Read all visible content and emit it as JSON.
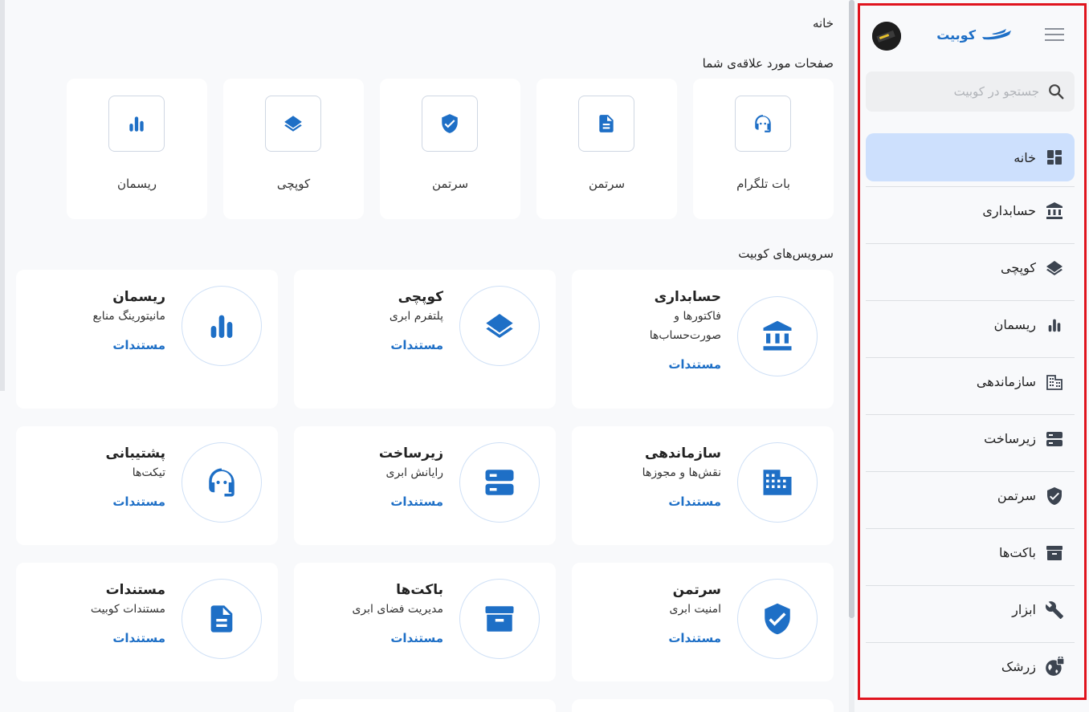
{
  "breadcrumb": "خانه",
  "favorites": {
    "title": "صفحات مورد علاقه‌ی شما",
    "items": [
      {
        "label": "بات تلگرام",
        "icon": "headset-icon"
      },
      {
        "label": "سرتمن",
        "icon": "document-icon"
      },
      {
        "label": "سرتمن",
        "icon": "shield-check-icon"
      },
      {
        "label": "کوپچی",
        "icon": "layers-icon"
      },
      {
        "label": "ریسمان",
        "icon": "bar-chart-icon"
      }
    ]
  },
  "services": {
    "title": "سرویس‌های کوبیت",
    "items": [
      {
        "name": "حسابداری",
        "desc": "فاکتورها و",
        "desc2": "صورت‌حساب‌ها",
        "link": "مستندات",
        "icon": "bank-icon"
      },
      {
        "name": "کوپچی",
        "desc": "پلتفرم ابری",
        "link": "مستندات",
        "icon": "layers-icon"
      },
      {
        "name": "ریسمان",
        "desc": "مانیتورینگ منابع",
        "link": "مستندات",
        "icon": "bar-chart-icon"
      },
      {
        "name": "سازماندهی",
        "desc": "نقش‌ها و مجوزها",
        "link": "مستندات",
        "icon": "building-icon"
      },
      {
        "name": "زیرساخت",
        "desc": "رایانش ابری",
        "link": "مستندات",
        "icon": "server-icon"
      },
      {
        "name": "پشتیبانی",
        "desc": "تیکت‌ها",
        "link": "مستندات",
        "icon": "headset-icon"
      },
      {
        "name": "سرتمن",
        "desc": "امنیت ابری",
        "link": "مستندات",
        "icon": "shield-check-icon"
      },
      {
        "name": "باکت‌ها",
        "desc": "مدیریت فضای ابری",
        "link": "مستندات",
        "icon": "archive-box-icon"
      },
      {
        "name": "مستندات",
        "desc": "مستندات کوبیت",
        "link": "مستندات",
        "icon": "document-icon"
      }
    ]
  },
  "sidebar": {
    "brand": "کوبیت",
    "search_placeholder": "جستجو در کوبیت",
    "items": [
      {
        "label": "خانه",
        "icon": "dashboard-icon",
        "active": true
      },
      {
        "label": "حسابداری",
        "icon": "bank-icon"
      },
      {
        "label": "کوپچی",
        "icon": "layers-icon"
      },
      {
        "label": "ریسمان",
        "icon": "bar-chart-icon"
      },
      {
        "label": "سازماندهی",
        "icon": "building-icon"
      },
      {
        "label": "زیرساخت",
        "icon": "server-icon"
      },
      {
        "label": "سرتمن",
        "icon": "shield-check-icon"
      },
      {
        "label": "باکت‌ها",
        "icon": "archive-box-icon"
      },
      {
        "label": "ابزار",
        "icon": "wrench-icon"
      },
      {
        "label": "زرشک",
        "icon": "globe-lock-icon"
      }
    ]
  },
  "colors": {
    "accent": "#1e6fc6",
    "active_bg": "#cde0fd",
    "highlight_border": "#e0141e"
  }
}
